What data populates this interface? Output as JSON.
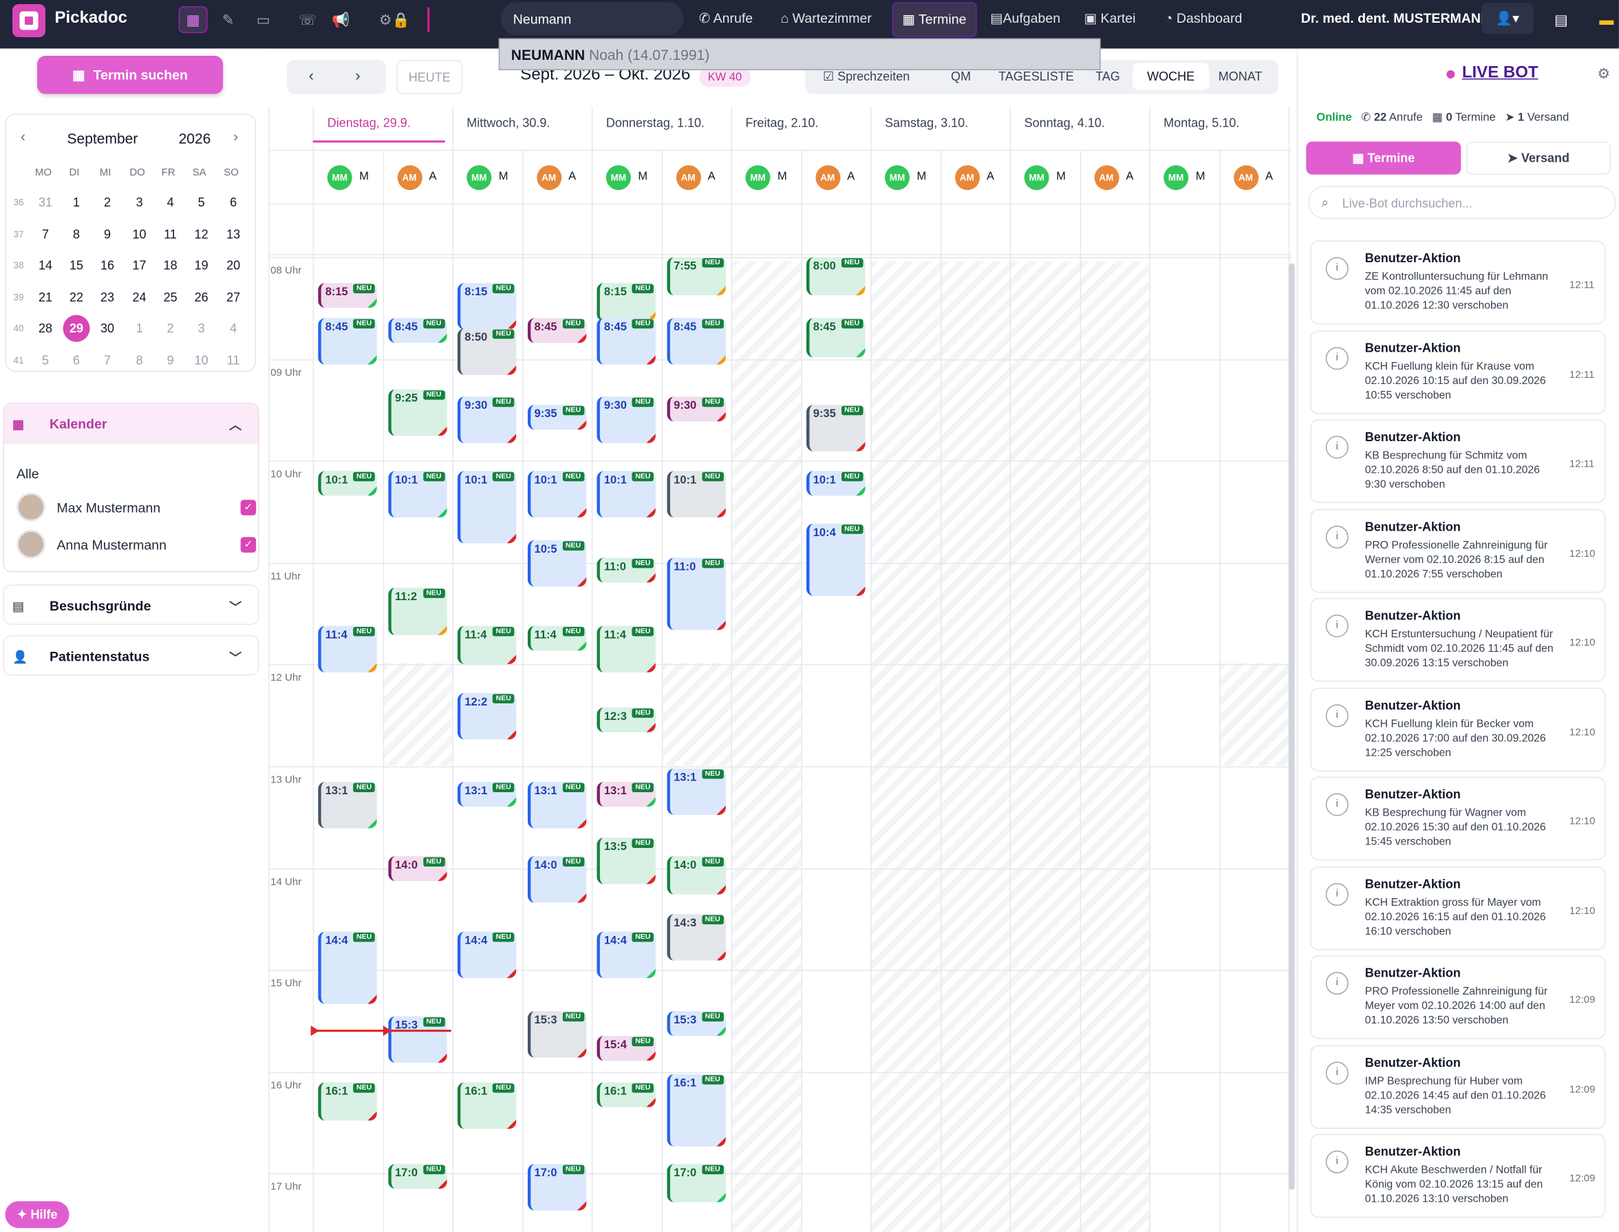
{
  "app": {
    "name": "Pickadoc"
  },
  "topbar": {
    "search_value": "Neumann",
    "nav": [
      "Anrufe",
      "Wartezimmer",
      "Termine",
      "Aufgaben",
      "Kartei",
      "Dashboard"
    ],
    "user": "Dr. med. dent. MUSTERMANN",
    "suggestion": {
      "name": "NEUMANN",
      "first": "Noah",
      "dob": "(14.07.1991)"
    }
  },
  "sidebar": {
    "search_button": "Termin suchen",
    "minical": {
      "month": "September",
      "year": "2026",
      "dow": [
        "MO",
        "DI",
        "MI",
        "DO",
        "FR",
        "SA",
        "SO"
      ],
      "weeks": [
        {
          "kw": "36",
          "days": [
            "31",
            "1",
            "2",
            "3",
            "4",
            "5",
            "6"
          ]
        },
        {
          "kw": "37",
          "days": [
            "7",
            "8",
            "9",
            "10",
            "11",
            "12",
            "13"
          ]
        },
        {
          "kw": "38",
          "days": [
            "14",
            "15",
            "16",
            "17",
            "18",
            "19",
            "20"
          ]
        },
        {
          "kw": "39",
          "days": [
            "21",
            "22",
            "23",
            "24",
            "25",
            "26",
            "27"
          ]
        },
        {
          "kw": "40",
          "days": [
            "28",
            "29",
            "30",
            "1",
            "2",
            "3",
            "4"
          ]
        },
        {
          "kw": "41",
          "days": [
            "5",
            "6",
            "7",
            "8",
            "9",
            "10",
            "11"
          ]
        }
      ],
      "today": "29"
    },
    "kalender": {
      "title": "Kalender",
      "all": "Alle",
      "people": [
        "Max Mustermann",
        "Anna Mustermann"
      ]
    },
    "besuchsgruende": "Besuchsgründe",
    "patientenstatus": "Patientenstatus",
    "help": "Hilfe"
  },
  "toolbar": {
    "today": "HEUTE",
    "range": "Sept. 2026 – Okt. 2026",
    "kw": "KW 40",
    "views": [
      "Sprechzeiten",
      "QM",
      "TAGESLISTE",
      "TAG",
      "WOCHE",
      "MONAT"
    ],
    "selected_view": "WOCHE"
  },
  "calendar": {
    "days": [
      "Dienstag, 29.9.",
      "Mittwoch, 30.9.",
      "Donnerstag, 1.10.",
      "Freitag, 2.10.",
      "Samstag, 3.10.",
      "Sonntag, 4.10.",
      "Montag, 5.10."
    ],
    "resources": [
      "MM",
      "AM"
    ],
    "resource_initials": [
      "M",
      "A"
    ],
    "hours": [
      "08 Uhr",
      "09 Uhr",
      "10 Uhr",
      "11 Uhr",
      "12 Uhr",
      "13 Uhr",
      "14 Uhr",
      "15 Uhr",
      "16 Uhr",
      "17 Uhr"
    ],
    "badge": "NEU",
    "appointments": [
      {
        "col": 0,
        "label": "8:15",
        "start": 8.25,
        "dur": 0.25,
        "c": "p",
        "f": "g"
      },
      {
        "col": 0,
        "label": "8:45",
        "start": 8.6,
        "dur": 0.5,
        "c": "b",
        "f": "g"
      },
      {
        "col": 0,
        "label": "10:1",
        "start": 10.1,
        "dur": 0.25,
        "c": "g",
        "f": "g"
      },
      {
        "col": 0,
        "label": "11:4",
        "start": 11.62,
        "dur": 0.5,
        "c": "b",
        "f": "o"
      },
      {
        "col": 0,
        "label": "13:1",
        "start": 13.15,
        "dur": 0.5,
        "c": "s",
        "f": "g"
      },
      {
        "col": 0,
        "label": "14:4",
        "start": 14.62,
        "dur": 0.75,
        "c": "b",
        "f": "r"
      },
      {
        "col": 0,
        "label": "16:1",
        "start": 16.1,
        "dur": 0.42,
        "c": "g",
        "f": "r"
      },
      {
        "col": 1,
        "label": "8:45",
        "start": 8.6,
        "dur": 0.25,
        "c": "b",
        "f": "g"
      },
      {
        "col": 1,
        "label": "9:25",
        "start": 9.3,
        "dur": 0.5,
        "c": "g",
        "f": "r"
      },
      {
        "col": 1,
        "label": "10:1",
        "start": 10.1,
        "dur": 0.5,
        "c": "b",
        "f": "g"
      },
      {
        "col": 1,
        "label": "11:2",
        "start": 11.25,
        "dur": 0.5,
        "c": "g",
        "f": "o"
      },
      {
        "col": 1,
        "label": "14:0",
        "start": 13.88,
        "dur": 0.25,
        "c": "p",
        "f": "r"
      },
      {
        "col": 1,
        "label": "15:3",
        "start": 15.45,
        "dur": 0.5,
        "c": "b",
        "f": "r"
      },
      {
        "col": 1,
        "label": "17:0",
        "start": 16.9,
        "dur": 0.25,
        "c": "g",
        "f": "r"
      },
      {
        "col": 2,
        "label": "8:15",
        "start": 8.25,
        "dur": 0.5,
        "c": "b",
        "f": "r"
      },
      {
        "col": 2,
        "label": "8:50",
        "start": 8.7,
        "dur": 0.5,
        "c": "s",
        "f": "r"
      },
      {
        "col": 2,
        "label": "9:30",
        "start": 9.37,
        "dur": 0.5,
        "c": "b",
        "f": "r"
      },
      {
        "col": 2,
        "label": "10:1",
        "start": 10.1,
        "dur": 0.75,
        "c": "b",
        "f": "r"
      },
      {
        "col": 2,
        "label": "11:4",
        "start": 11.62,
        "dur": 0.42,
        "c": "g",
        "f": "r"
      },
      {
        "col": 2,
        "label": "12:2",
        "start": 12.28,
        "dur": 0.5,
        "c": "b",
        "f": "r"
      },
      {
        "col": 2,
        "label": "13:1",
        "start": 13.15,
        "dur": 0.25,
        "c": "b",
        "f": "g"
      },
      {
        "col": 2,
        "label": "14:4",
        "start": 14.62,
        "dur": 0.5,
        "c": "b",
        "f": "r"
      },
      {
        "col": 2,
        "label": "16:1",
        "start": 16.1,
        "dur": 0.5,
        "c": "g",
        "f": "r"
      },
      {
        "col": 3,
        "label": "8:45",
        "start": 8.6,
        "dur": 0.25,
        "c": "p",
        "f": "r"
      },
      {
        "col": 3,
        "label": "9:35",
        "start": 9.45,
        "dur": 0.25,
        "c": "b",
        "f": "r"
      },
      {
        "col": 3,
        "label": "10:1",
        "start": 10.1,
        "dur": 0.5,
        "c": "b",
        "f": "r"
      },
      {
        "col": 3,
        "label": "10:5",
        "start": 10.78,
        "dur": 0.5,
        "c": "b",
        "f": "r"
      },
      {
        "col": 3,
        "label": "11:4",
        "start": 11.62,
        "dur": 0.25,
        "c": "g",
        "f": "g"
      },
      {
        "col": 3,
        "label": "13:1",
        "start": 13.15,
        "dur": 0.5,
        "c": "b",
        "f": "r"
      },
      {
        "col": 3,
        "label": "14:0",
        "start": 13.88,
        "dur": 0.5,
        "c": "b",
        "f": "r"
      },
      {
        "col": 3,
        "label": "15:3",
        "start": 15.4,
        "dur": 0.5,
        "c": "s",
        "f": "r"
      },
      {
        "col": 3,
        "label": "17:0",
        "start": 16.9,
        "dur": 0.5,
        "c": "b",
        "f": "r"
      },
      {
        "col": 4,
        "label": "8:15",
        "start": 8.25,
        "dur": 0.42,
        "c": "g",
        "f": "o"
      },
      {
        "col": 4,
        "label": "8:45",
        "start": 8.6,
        "dur": 0.5,
        "c": "b",
        "f": "r"
      },
      {
        "col": 4,
        "label": "9:30",
        "start": 9.37,
        "dur": 0.5,
        "c": "b",
        "f": "r"
      },
      {
        "col": 4,
        "label": "10:1",
        "start": 10.1,
        "dur": 0.5,
        "c": "b",
        "f": "r"
      },
      {
        "col": 4,
        "label": "11:0",
        "start": 10.95,
        "dur": 0.25,
        "c": "g",
        "f": "r"
      },
      {
        "col": 4,
        "label": "11:4",
        "start": 11.62,
        "dur": 0.5,
        "c": "g",
        "f": "r"
      },
      {
        "col": 4,
        "label": "12:3",
        "start": 12.42,
        "dur": 0.25,
        "c": "g",
        "f": "r"
      },
      {
        "col": 4,
        "label": "13:1",
        "start": 13.15,
        "dur": 0.25,
        "c": "p",
        "f": "g"
      },
      {
        "col": 4,
        "label": "13:5",
        "start": 13.7,
        "dur": 0.5,
        "c": "g",
        "f": "r"
      },
      {
        "col": 4,
        "label": "14:4",
        "start": 14.62,
        "dur": 0.5,
        "c": "b",
        "f": "g"
      },
      {
        "col": 4,
        "label": "15:4",
        "start": 15.65,
        "dur": 0.25,
        "c": "p",
        "f": "r"
      },
      {
        "col": 4,
        "label": "16:1",
        "start": 16.1,
        "dur": 0.25,
        "c": "g",
        "f": "r"
      },
      {
        "col": 5,
        "label": "7:55",
        "start": 8.0,
        "dur": 0.42,
        "c": "g",
        "f": "o"
      },
      {
        "col": 5,
        "label": "8:45",
        "start": 8.6,
        "dur": 0.5,
        "c": "b",
        "f": "o"
      },
      {
        "col": 5,
        "label": "9:30",
        "start": 9.37,
        "dur": 0.25,
        "c": "p",
        "f": "r"
      },
      {
        "col": 5,
        "label": "10:1",
        "start": 10.1,
        "dur": 0.5,
        "c": "s",
        "f": "r"
      },
      {
        "col": 5,
        "label": "11:0",
        "start": 10.95,
        "dur": 0.75,
        "c": "b",
        "f": "r"
      },
      {
        "col": 5,
        "label": "13:1",
        "start": 13.02,
        "dur": 0.5,
        "c": "b",
        "f": "r"
      },
      {
        "col": 5,
        "label": "14:0",
        "start": 13.88,
        "dur": 0.42,
        "c": "g",
        "f": "r"
      },
      {
        "col": 5,
        "label": "14:3",
        "start": 14.45,
        "dur": 0.5,
        "c": "s",
        "f": "r"
      },
      {
        "col": 5,
        "label": "15:3",
        "start": 15.4,
        "dur": 0.25,
        "c": "b",
        "f": "g"
      },
      {
        "col": 5,
        "label": "16:1",
        "start": 16.02,
        "dur": 0.75,
        "c": "b",
        "f": "r"
      },
      {
        "col": 5,
        "label": "17:0",
        "start": 16.9,
        "dur": 0.42,
        "c": "g",
        "f": "g"
      },
      {
        "col": 7,
        "label": "8:00",
        "start": 8.0,
        "dur": 0.42,
        "c": "g",
        "f": "o"
      },
      {
        "col": 7,
        "label": "8:45",
        "start": 8.6,
        "dur": 0.42,
        "c": "g",
        "f": "g"
      },
      {
        "col": 7,
        "label": "9:35",
        "start": 9.45,
        "dur": 0.5,
        "c": "s",
        "f": "r"
      },
      {
        "col": 7,
        "label": "10:1",
        "start": 10.1,
        "dur": 0.25,
        "c": "b",
        "f": "g"
      },
      {
        "col": 7,
        "label": "10:4",
        "start": 10.62,
        "dur": 0.75,
        "c": "b",
        "f": "r"
      }
    ]
  },
  "livebot": {
    "title": "LIVE BOT",
    "status": "Online",
    "calls_count": "22",
    "calls_label": "Anrufe",
    "termine_count": "0",
    "termine_label": "Termine",
    "versand_count": "1",
    "versand_label": "Versand",
    "tab_termine": "Termine",
    "tab_versand": "Versand",
    "search_placeholder": "Live-Bot durchsuchen...",
    "items": [
      {
        "title": "Benutzer-Aktion",
        "text": "ZE Kontrolluntersuchung für Lehmann vom 02.10.2026 11:45 auf den 01.10.2026 12:30 verschoben",
        "time": "12:11"
      },
      {
        "title": "Benutzer-Aktion",
        "text": "KCH Fuellung klein für Krause vom 02.10.2026 10:15 auf den 30.09.2026 10:55 verschoben",
        "time": "12:11"
      },
      {
        "title": "Benutzer-Aktion",
        "text": "KB Besprechung für Schmitz vom 02.10.2026 8:50 auf den 01.10.2026 9:30 verschoben",
        "time": "12:11"
      },
      {
        "title": "Benutzer-Aktion",
        "text": "PRO Professionelle Zahnreinigung für Werner vom 02.10.2026 8:15 auf den 01.10.2026 7:55 verschoben",
        "time": "12:10"
      },
      {
        "title": "Benutzer-Aktion",
        "text": "KCH Erstuntersuchung / Neupatient für Schmidt vom 02.10.2026 11:45 auf den 30.09.2026 13:15 verschoben",
        "time": "12:10"
      },
      {
        "title": "Benutzer-Aktion",
        "text": "KCH Fuellung klein für Becker vom 02.10.2026 17:00 auf den 30.09.2026 12:25 verschoben",
        "time": "12:10"
      },
      {
        "title": "Benutzer-Aktion",
        "text": "KB Besprechung für Wagner vom 02.10.2026 15:30 auf den 01.10.2026 15:45 verschoben",
        "time": "12:10"
      },
      {
        "title": "Benutzer-Aktion",
        "text": "KCH Extraktion gross für Mayer vom 02.10.2026 16:15 auf den 01.10.2026 16:10 verschoben",
        "time": "12:10"
      },
      {
        "title": "Benutzer-Aktion",
        "text": "PRO Professionelle Zahnreinigung für Meyer vom 02.10.2026 14:00 auf den 01.10.2026 13:50 verschoben",
        "time": "12:09"
      },
      {
        "title": "Benutzer-Aktion",
        "text": "IMP Besprechung für Huber vom 02.10.2026 14:45 auf den 01.10.2026 14:35 verschoben",
        "time": "12:09"
      },
      {
        "title": "Benutzer-Aktion",
        "text": "KCH Akute Beschwerden / Notfall für König vom 02.10.2026 13:15 auf den 01.10.2026 13:10 verschoben",
        "time": "12:09"
      }
    ]
  }
}
